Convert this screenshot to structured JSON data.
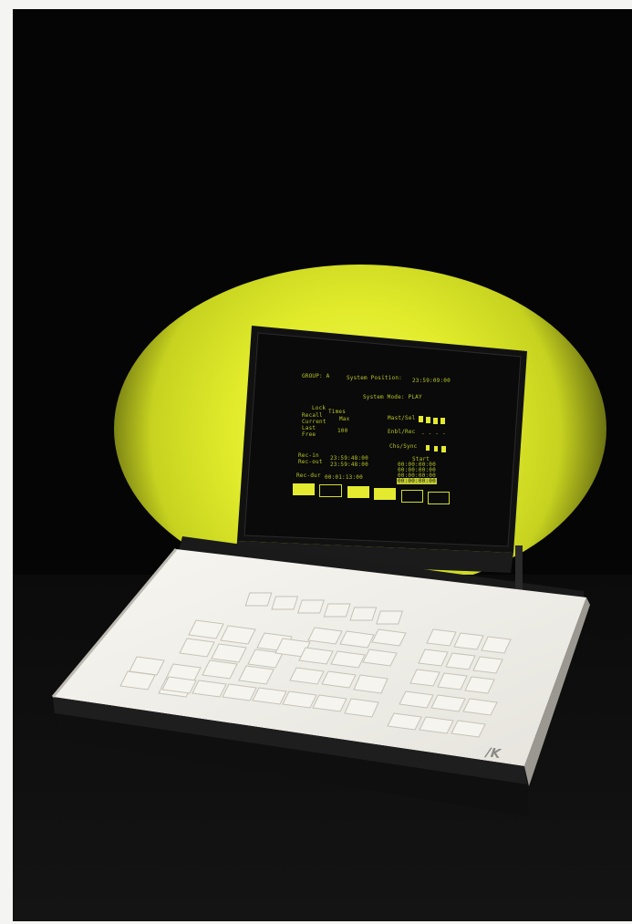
{
  "monitor": {
    "group": "GROUP: A",
    "system_position_label": "System Position:",
    "system_position_value": "23:59:09:00",
    "system_mode": "System Mode: PLAY",
    "lock_header_lines": [
      "Lock",
      "Times"
    ],
    "recall_labels": [
      "Recall",
      "Current",
      "Last",
      "Free"
    ],
    "lock_values": [
      "Max",
      "100"
    ],
    "status_labels": [
      "Mast/Sel",
      "Enbl/Rec",
      "Chs/Sync"
    ],
    "status_dashes": "- - - -",
    "start_header": "Start",
    "rec_labels": [
      "Rec-in",
      "Rec-out"
    ],
    "rec_values": [
      "23:59:48:00",
      "23:59:48:00"
    ],
    "start_times": [
      "00:00:00:00",
      "00:00:00:00",
      "00:00:00:00",
      "00:00:00:00"
    ],
    "rec_dur_label": "Rec-dur",
    "rec_dur_value": "00:01:13:00"
  },
  "colors": {
    "background": "#050505",
    "spotlight": "#e6ef2d",
    "screen_text": "#c9d82a",
    "panel": "#efeee8"
  }
}
